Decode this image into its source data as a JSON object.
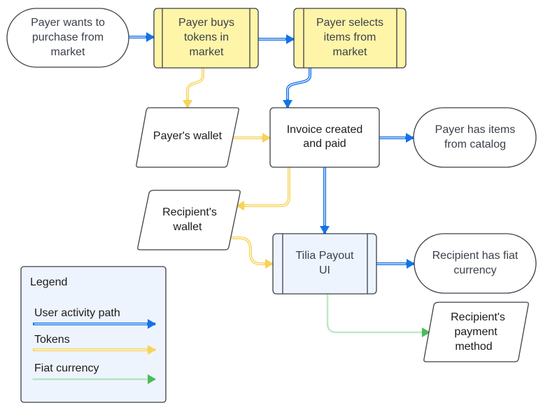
{
  "colors": {
    "user_activity": "#1473e6",
    "tokens": "#f7d35a",
    "fiat": "#4cbb5a",
    "process_yellow": "#fff5a8",
    "process_blue": "#eef4fd"
  },
  "nodes": {
    "start": {
      "lines": [
        "Payer wants to",
        "purchase from",
        "market"
      ]
    },
    "buys_tokens": {
      "lines": [
        "Payer buys",
        "tokens in",
        "market"
      ]
    },
    "selects_items": {
      "lines": [
        "Payer selects",
        "items from",
        "market"
      ]
    },
    "payer_wallet": {
      "lines": [
        "Payer's wallet"
      ]
    },
    "invoice": {
      "lines": [
        "Invoice created",
        "and paid"
      ]
    },
    "payer_has_items": {
      "lines": [
        "Payer has items",
        "from catalog"
      ]
    },
    "recipient_wallet": {
      "lines": [
        "Recipient's",
        "wallet"
      ]
    },
    "tilia_payout": {
      "lines": [
        "Tilia Payout",
        "UI"
      ]
    },
    "recipient_fiat": {
      "lines": [
        "Recipient has fiat",
        "currency"
      ]
    },
    "payment_method": {
      "lines": [
        "Recipient's",
        "payment",
        "method"
      ]
    }
  },
  "legend": {
    "title": "Legend",
    "items": [
      {
        "label": "User activity path",
        "type": "user_activity"
      },
      {
        "label": "Tokens",
        "type": "tokens"
      },
      {
        "label": "Fiat currency",
        "type": "fiat"
      }
    ]
  }
}
